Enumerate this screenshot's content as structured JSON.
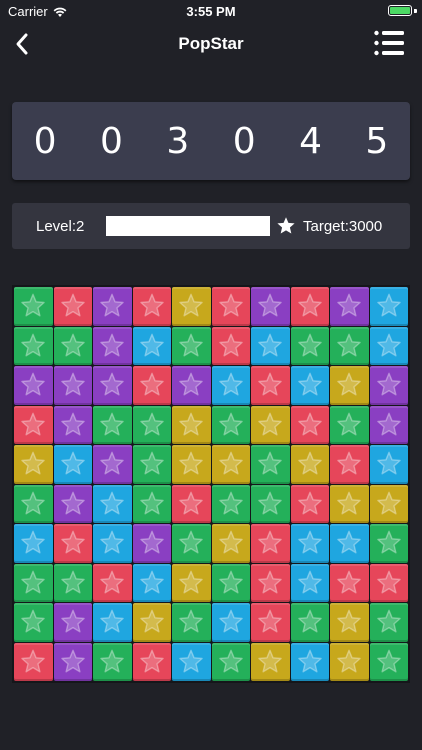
{
  "status_bar": {
    "carrier": "Carrier",
    "time": "3:55 PM"
  },
  "nav": {
    "title": "PopStar",
    "back_icon": "chevron-left-icon",
    "menu_icon": "list-menu-icon"
  },
  "score": {
    "value": "0 0 3 0 4 5"
  },
  "level": {
    "level_label": "Level:2",
    "progress_fraction": 1.0,
    "target_label": "Target:3000"
  },
  "colors": {
    "green": "#24b05a",
    "red": "#e6465a",
    "purple": "#8a3fc2",
    "blue": "#1fa6e0",
    "yellow": "#c7a81c",
    "background": "#202127",
    "score_panel": "#3b3d4e"
  },
  "board": {
    "rows": [
      [
        "green",
        "red",
        "purple",
        "red",
        "yellow",
        "red",
        "purple",
        "red",
        "purple",
        "blue"
      ],
      [
        "green",
        "green",
        "purple",
        "blue",
        "green",
        "red",
        "blue",
        "green",
        "green",
        "blue"
      ],
      [
        "purple",
        "purple",
        "purple",
        "red",
        "purple",
        "blue",
        "red",
        "blue",
        "yellow",
        "purple"
      ],
      [
        "red",
        "purple",
        "green",
        "green",
        "yellow",
        "green",
        "yellow",
        "red",
        "green",
        "purple"
      ],
      [
        "yellow",
        "blue",
        "purple",
        "green",
        "yellow",
        "yellow",
        "green",
        "yellow",
        "red",
        "blue"
      ],
      [
        "green",
        "purple",
        "blue",
        "green",
        "red",
        "green",
        "green",
        "red",
        "yellow",
        "yellow"
      ],
      [
        "blue",
        "red",
        "blue",
        "purple",
        "green",
        "yellow",
        "red",
        "blue",
        "blue",
        "green"
      ],
      [
        "green",
        "green",
        "red",
        "blue",
        "yellow",
        "green",
        "red",
        "blue",
        "red",
        "red"
      ],
      [
        "green",
        "purple",
        "blue",
        "yellow",
        "green",
        "blue",
        "red",
        "green",
        "yellow",
        "green"
      ],
      [
        "red",
        "purple",
        "green",
        "red",
        "blue",
        "green",
        "yellow",
        "blue",
        "yellow",
        "green"
      ]
    ]
  }
}
